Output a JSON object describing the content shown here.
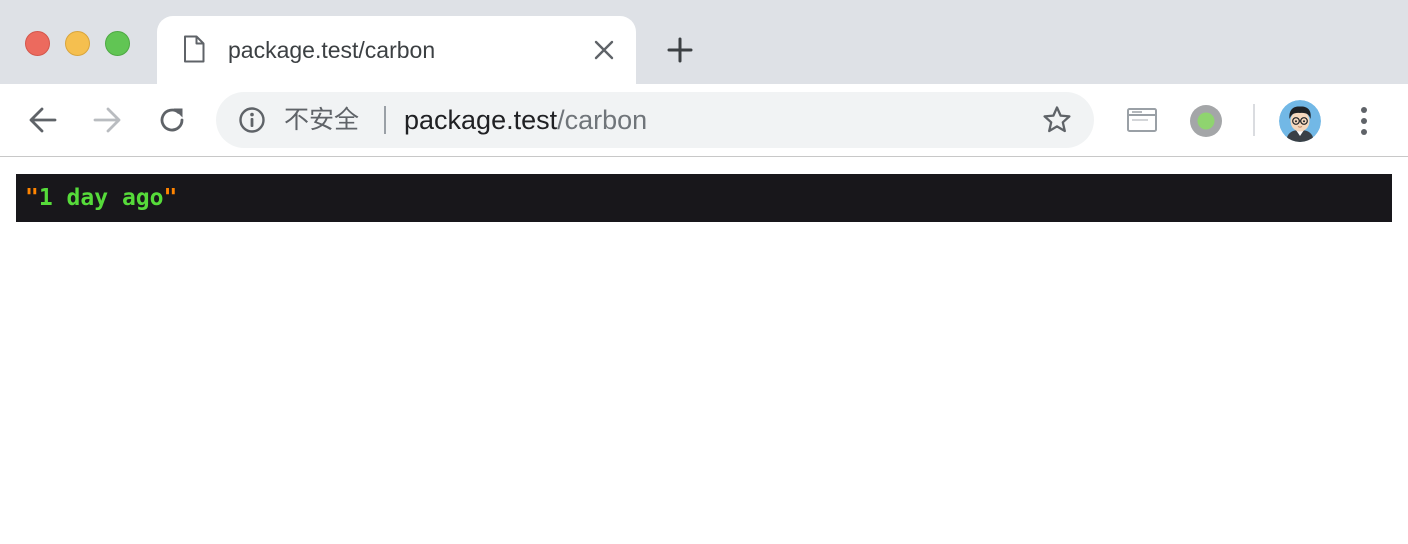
{
  "tab": {
    "title": "package.test/carbon",
    "page_icon": "page-icon",
    "close_icon": "close-icon"
  },
  "new_tab_icon": "plus-icon",
  "toolbar": {
    "back_icon": "arrow-left-icon",
    "forward_icon": "arrow-right-icon",
    "reload_icon": "reload-icon",
    "security_label": "不安全",
    "url_host": "package.test",
    "url_path": "/carbon",
    "bookmark_icon": "star-icon",
    "extensions": [
      "window-icon",
      "record-icon"
    ],
    "avatar": "avatar",
    "menu_icon": "kebab-menu-icon"
  },
  "dump": {
    "quote_open": "\"",
    "value": "1 day ago",
    "quote_close": "\""
  },
  "colors": {
    "tabstrip_bg": "#dee1e6",
    "omnibox_bg": "#f1f3f4",
    "dump_bg": "#18171b",
    "dump_string": "#56db3a",
    "dump_quote": "#ff8400",
    "traffic_close": "#ec6a5e",
    "traffic_minimize": "#f5bf4f",
    "traffic_maximize": "#61c554"
  }
}
